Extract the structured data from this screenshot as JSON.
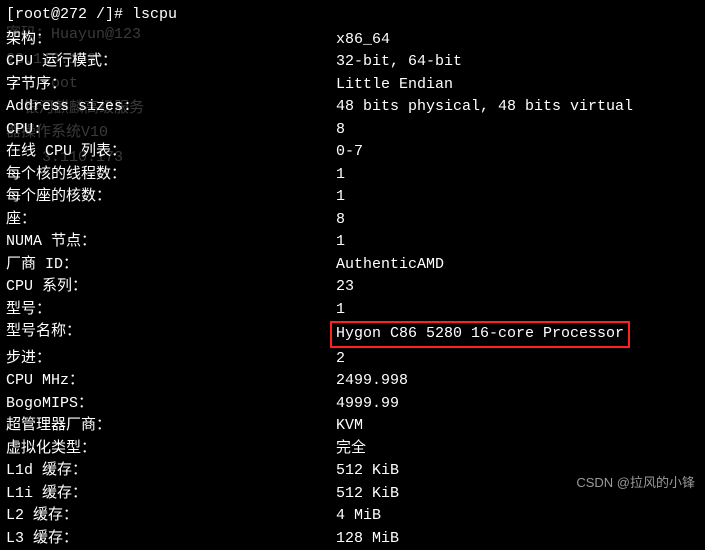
{
  "prompt": "[root@272 /]# lscpu",
  "ghost": {
    "line1": "密码：Huayun@123",
    "line2": "",
    "line3": "23.110.173",
    "line4": "    root",
    "line5": "",
    "line6": "",
    "line7": "",
    "line8": "  银河麒麟高级服务",
    "line9": "器操作系统V10",
    "line10": "    3.110.173"
  },
  "rows": [
    {
      "label": "架构：",
      "value": "x86_64"
    },
    {
      "label": "CPU 运行模式：",
      "value": "32-bit, 64-bit"
    },
    {
      "label": "字节序：",
      "value": "Little Endian"
    },
    {
      "label": "Address sizes:",
      "value": "48 bits physical, 48 bits virtual"
    },
    {
      "label": "CPU:",
      "value": "8"
    },
    {
      "label": "在线 CPU 列表：",
      "value": "0-7"
    },
    {
      "label": "每个核的线程数：",
      "value": "1"
    },
    {
      "label": "每个座的核数：",
      "value": "1"
    },
    {
      "label": "座：",
      "value": "8"
    },
    {
      "label": "NUMA 节点：",
      "value": "1"
    },
    {
      "label": "厂商 ID：",
      "value": "AuthenticAMD"
    },
    {
      "label": "CPU 系列：",
      "value": "23"
    },
    {
      "label": "型号：",
      "value": "1"
    },
    {
      "label": "型号名称：",
      "value": "Hygon C86 5280 16-core Processor",
      "highlight": true
    },
    {
      "label": "步进：",
      "value": "2"
    },
    {
      "label": "CPU MHz：",
      "value": "2499.998"
    },
    {
      "label": "BogoMIPS：",
      "value": "4999.99"
    },
    {
      "label": "超管理器厂商：",
      "value": "KVM"
    },
    {
      "label": "虚拟化类型：",
      "value": "完全"
    },
    {
      "label": "L1d 缓存：",
      "value": "512 KiB"
    },
    {
      "label": "L1i 缓存：",
      "value": "512 KiB"
    },
    {
      "label": "L2 缓存：",
      "value": "4 MiB"
    },
    {
      "label": "L3 缓存：",
      "value": "128 MiB"
    }
  ],
  "watermark": "CSDN @拉风的小锋"
}
